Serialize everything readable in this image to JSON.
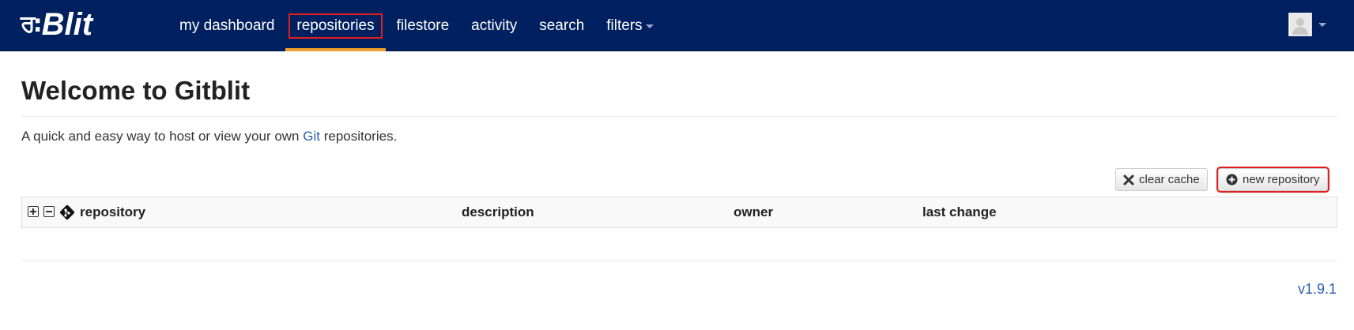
{
  "navbar": {
    "brand": {
      "glyph": "ਰ:",
      "text": "Blit"
    },
    "items": [
      {
        "label": "my dashboard"
      },
      {
        "label": "repositories"
      },
      {
        "label": "filestore"
      },
      {
        "label": "activity"
      },
      {
        "label": "search"
      },
      {
        "label": "filters"
      }
    ],
    "active_item": "repositories",
    "background": "#002060",
    "active_underline": "#f0a030"
  },
  "page": {
    "title": "Welcome to Gitblit",
    "intro_before": "A quick and easy way to host or view your own ",
    "intro_link": "Git",
    "intro_after": " repositories."
  },
  "toolbar": {
    "clear_cache_label": "clear cache",
    "clear_cache_icon": "close-icon",
    "new_repository_label": "new repository",
    "new_repository_icon": "plus-circle-icon"
  },
  "table": {
    "columns": [
      "repository",
      "description",
      "owner",
      "last change"
    ],
    "rows": []
  },
  "footer": {
    "version": "v1.9.1"
  },
  "colors": {
    "link": "#2a5db0",
    "highlight": "#e0201e"
  }
}
